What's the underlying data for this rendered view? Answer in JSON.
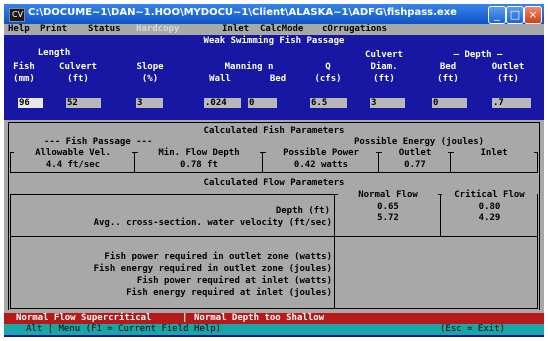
{
  "window": {
    "icon_label": "CV",
    "title": "C:\\DOCUME~1\\DAN~1.HOO\\MYDOCU~1\\Client\\ALASKA~1\\ADFG\\fishpass.exe",
    "minimize": "_",
    "maximize": "□",
    "close": "×"
  },
  "menu": {
    "help": "Help",
    "print": "Print",
    "status": "Status",
    "disabled": "Hardcopy",
    "inlet": "Inlet",
    "calcmode": "CalcMode",
    "corrugations": "cOrrugations"
  },
  "inputs": {
    "title": "Weak Swimming Fish Passage",
    "headers": {
      "length": "Length",
      "fish": "Fish",
      "fish_unit": "(mm)",
      "culvert": "Culvert",
      "culvert_unit": "(ft)",
      "slope": "Slope",
      "slope_unit": "(%)",
      "manning": "Manning n",
      "wall": "Wall",
      "bed": "Bed",
      "q": "Q",
      "q_unit": "(cfs)",
      "culvert_diam": "Culvert",
      "diam": "Diam.",
      "diam_unit": "(ft)",
      "depth": "— Depth —",
      "depth_bed": "Bed",
      "depth_bed_unit": "(ft)",
      "outlet": "Outlet",
      "outlet_unit": "(ft)"
    },
    "values": {
      "fish_mm": "96",
      "culvert_ft": "52",
      "slope_pct": "3",
      "manning_wall": ".024",
      "manning_bed": "0",
      "q_cfs": "6.5",
      "diam_ft": "3",
      "bed_depth": "0",
      "outlet_depth": ".7"
    }
  },
  "fish_params": {
    "title": "Calculated Fish Parameters",
    "fish_passage": "--- Fish Passage ---",
    "possible_energy": "Possible Energy (joules)",
    "allowable_vel_label": "Allowable Vel.",
    "allowable_vel": "4.4 ft/sec",
    "min_flow_depth_label": "Min. Flow Depth",
    "min_flow_depth": "0.78 ft",
    "possible_power_label": "Possible Power",
    "possible_power": "0.42 watts",
    "outlet_label": "Outlet",
    "outlet_energy": "0.77",
    "inlet_label": "Inlet",
    "inlet_energy": ""
  },
  "flow_params": {
    "title": "Calculated Flow Parameters",
    "normal_flow": "Normal Flow",
    "critical_flow": "Critical Flow",
    "depth_label": "Depth (ft)",
    "velocity_label": "Avg.. cross-section. water velocity (ft/sec)",
    "normal_depth": "0.65",
    "normal_velocity": "5.72",
    "critical_depth": "0.80",
    "critical_velocity": "4.29",
    "power_outlet": "Fish power required in outlet zone (watts)",
    "energy_outlet": "Fish energy required in outlet zone (joules)",
    "power_inlet": "Fish power required at inlet (watts)",
    "energy_inlet": "Fish energy required at inlet (joules)"
  },
  "status": {
    "left": "Normal Flow Supercritical",
    "right": "Normal Depth too Shallow"
  },
  "help": {
    "left": "Alt | Menu (F1 = Current Field Help)",
    "right": "(Esc = Exit)"
  },
  "colors": {
    "console_bg": "#1717a3",
    "menu_bg": "#a8a8a8",
    "status_bg": "#b81818",
    "help_bg": "#18a6a6",
    "titlebar": "#0a52c8"
  }
}
